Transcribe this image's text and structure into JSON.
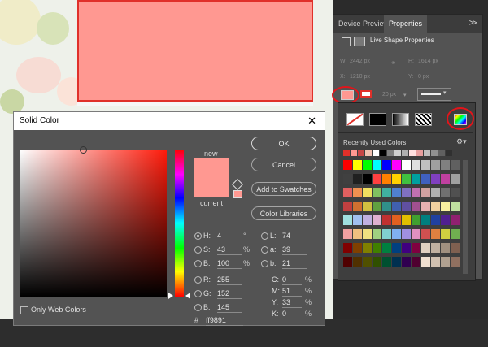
{
  "panel": {
    "tab_device_preview": "Device Preview",
    "tab_properties": "Properties",
    "title": "Live Shape Properties",
    "w_label": "W:",
    "w_value": "2442 px",
    "h_label": "H:",
    "h_value": "1614 px",
    "x_label": "X:",
    "x_value": "1210 px",
    "y_label": "Y:",
    "y_value": "0 px",
    "stroke_size": "20 px",
    "recent_colors_label": "Recently Used Colors",
    "shape_fill_color": "#ff9891"
  },
  "dialog": {
    "title": "Solid Color",
    "new_label": "new",
    "current_label": "current",
    "ok": "OK",
    "cancel": "Cancel",
    "add_to_swatches": "Add to Swatches",
    "color_libraries": "Color Libraries",
    "only_web_colors": "Only Web Colors",
    "new_color": "#ff9891",
    "current_color": "#ff9891",
    "hsb": {
      "H_label": "H:",
      "H": "4",
      "H_unit": "°",
      "S_label": "S:",
      "S": "43",
      "S_unit": "%",
      "B_label": "B:",
      "B": "100",
      "B_unit": "%"
    },
    "rgb": {
      "R_label": "R:",
      "R": "255",
      "G_label": "G:",
      "G": "152",
      "B_label": "B:",
      "B": "145"
    },
    "lab": {
      "L_label": "L:",
      "L": "74",
      "a_label": "a:",
      "a": "39",
      "b_label": "b:",
      "b": "21"
    },
    "cmyk": {
      "C_label": "C:",
      "C": "0",
      "C_unit": "%",
      "M_label": "M:",
      "M": "51",
      "M_unit": "%",
      "Y_label": "Y:",
      "Y": "33",
      "Y_unit": "%",
      "K_label": "K:",
      "K": "0",
      "K_unit": "%"
    },
    "hex_label": "#",
    "hex": "ff9891"
  },
  "recent_colors": [
    "#e0302a",
    "#ff9891",
    "#c64545",
    "#f0c0b0",
    "#ffffff",
    "#000000",
    "#808080",
    "#d0d0d0",
    "#b0b0b0",
    "#ffe0e0",
    "#e8a0a0",
    "#c0c0c0",
    "#909090",
    "#606060",
    "#303030"
  ],
  "swatch_grid": [
    [
      "#ff0000",
      "#ffff00",
      "#00ff00",
      "#00ffff",
      "#0000ff",
      "#ff00ff",
      "#ffffff",
      "#e0e0e0",
      "#c0c0c0",
      "#a0a0a0",
      "#808080",
      "#606060"
    ],
    [
      "#404040",
      "#202020",
      "#000000",
      "#ff4040",
      "#ff8000",
      "#ffd000",
      "#40c040",
      "#00a0a0",
      "#4060c0",
      "#8040c0",
      "#c040a0",
      "#a0a0a0"
    ],
    [
      "#e06060",
      "#f09050",
      "#f0e060",
      "#80c060",
      "#40b0a0",
      "#5080d0",
      "#8070c0",
      "#c070b0",
      "#d0a0a0",
      "#b0b0b0",
      "#707070",
      "#505050"
    ],
    [
      "#c04040",
      "#d07030",
      "#d0c040",
      "#60a040",
      "#30908a",
      "#4060b0",
      "#6050a0",
      "#a05090",
      "#e8b0b0",
      "#f0d0a0",
      "#f8f0a0",
      "#c0e0a0"
    ],
    [
      "#a0e0e0",
      "#a0c0f0",
      "#c0b0e0",
      "#e0b0d0",
      "#c03030",
      "#e06020",
      "#e0c000",
      "#40a030",
      "#008080",
      "#2040a0",
      "#502090",
      "#902070"
    ],
    [
      "#f0a0a0",
      "#f0c080",
      "#f0e080",
      "#a0d080",
      "#80d0d0",
      "#80b0f0",
      "#a090e0",
      "#e090c0",
      "#d05050",
      "#e08040",
      "#d0d040",
      "#70b050"
    ],
    [
      "#800000",
      "#804000",
      "#808000",
      "#408000",
      "#008040",
      "#004080",
      "#400080",
      "#800040",
      "#e0d0c0",
      "#c0b0a0",
      "#a09080",
      "#806050"
    ],
    [
      "#500000",
      "#503000",
      "#505000",
      "#305000",
      "#005030",
      "#003050",
      "#300050",
      "#500030",
      "#f0e0d0",
      "#d0c0b0",
      "#b0a090",
      "#907060"
    ]
  ]
}
